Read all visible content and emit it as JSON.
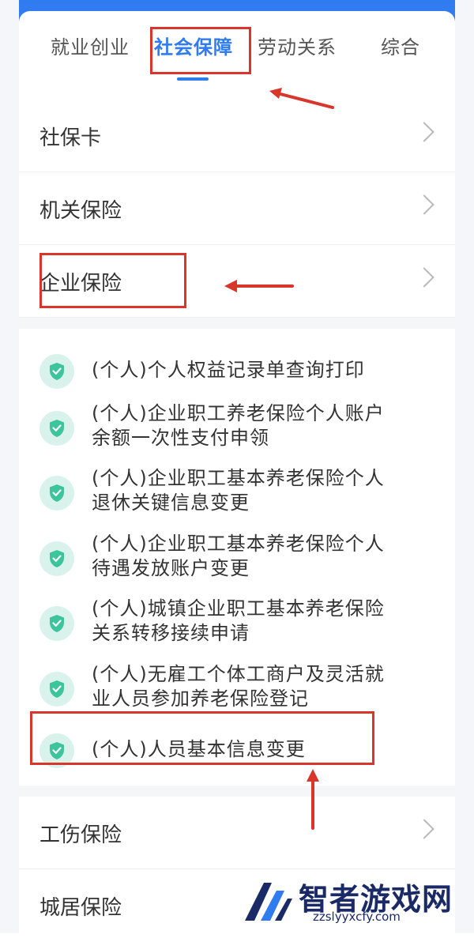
{
  "tabs": [
    {
      "label": "就业创业",
      "active": false
    },
    {
      "label": "社会保障",
      "active": true
    },
    {
      "label": "劳动关系",
      "active": false
    },
    {
      "label": "综合",
      "active": false
    }
  ],
  "categories": {
    "shebaoka": "社保卡",
    "jiguan": "机关保险",
    "qiye": "企业保险",
    "gongshang": "工伤保险",
    "chengju": "城居保险"
  },
  "services": [
    {
      "line1": "(个人)个人权益记录单查询打印",
      "line2": ""
    },
    {
      "line1": "(个人)企业职工养老保险个人账户",
      "line2": "余额一次性支付申领"
    },
    {
      "line1": "(个人)企业职工基本养老保险个人",
      "line2": "退休关键信息变更"
    },
    {
      "line1": "(个人)企业职工基本养老保险个人",
      "line2": "待遇发放账户变更"
    },
    {
      "line1": "(个人)城镇企业职工基本养老保险",
      "line2": "关系转移接续申请"
    },
    {
      "line1": "(个人)无雇工个体工商户及灵活就",
      "line2": "业人员参加养老保险登记"
    },
    {
      "line1": "(个人)人员基本信息变更",
      "line2": ""
    }
  ],
  "colors": {
    "accent": "#2f7bf0",
    "annotation": "#d9362b",
    "service_icon_bg": "#d9f3ec",
    "service_icon": "#3cc49a"
  },
  "icons": {
    "service": "shield-check-icon",
    "row": "chevron-right-icon"
  },
  "watermark": {
    "title": "智者游戏网",
    "url": "zzslyyxcfy.com"
  }
}
